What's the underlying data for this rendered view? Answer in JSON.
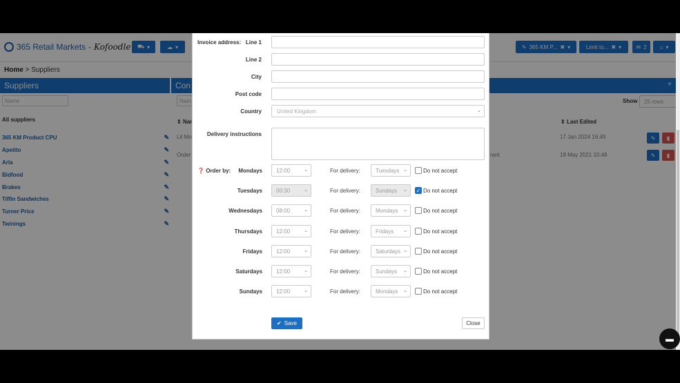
{
  "nav": {
    "brand": "365 Retail Markets",
    "brand_sep": "-",
    "brand_sub": "Kofoodle",
    "site_label": "365 KM P...",
    "limit_label": "Limit to...",
    "badge": "2"
  },
  "breadcrumb": {
    "home": "Home",
    "sep": ">",
    "current": "Suppliers"
  },
  "sidebar": {
    "title": "Suppliers",
    "search_placeholder": "Name",
    "all_label": "All suppliers",
    "items": [
      "365 KM Product CPU",
      "Apetito",
      "Arla",
      "Bidfood",
      "Brakes",
      "Tiffin Sandwiches",
      "Turner Price",
      "Twinings"
    ]
  },
  "content": {
    "title": "Con",
    "search_placeholder": "Nam",
    "show_label": "Show",
    "show_value": "25 rows",
    "col_name": "Nam",
    "col_last_edited": "Last Edited",
    "rows": [
      {
        "name": "Lit Mo",
        "extra": "",
        "edited": "17 Jan 2024 16:49"
      },
      {
        "name": "Order",
        "extra": "rant",
        "edited": "19 May 2021 10:48"
      }
    ]
  },
  "modal": {
    "invoice_label": "Invoice address:",
    "line1_label": "Line 1",
    "line2_label": "Line 2",
    "city_label": "City",
    "postcode_label": "Post code",
    "country_label": "Country",
    "country_value": "United Kingdom",
    "delivery_label": "Delivery instructions",
    "order_by_label": "Order by:",
    "for_delivery_label": "For delivery:",
    "do_not_accept_label": "Do not accept",
    "days": [
      {
        "day": "Mondays",
        "time": "12:00",
        "delivery": "Tuesdays",
        "disabled": false,
        "checked": false
      },
      {
        "day": "Tuesdays",
        "time": "00:30",
        "delivery": "Sundays",
        "disabled": true,
        "checked": true
      },
      {
        "day": "Wednesdays",
        "time": "08:00",
        "delivery": "Mondays",
        "disabled": false,
        "checked": false
      },
      {
        "day": "Thursdays",
        "time": "12:00",
        "delivery": "Fridays",
        "disabled": false,
        "checked": false
      },
      {
        "day": "Fridays",
        "time": "12:00",
        "delivery": "Saturdays",
        "disabled": false,
        "checked": false
      },
      {
        "day": "Saturdays",
        "time": "12:00",
        "delivery": "Sundays",
        "disabled": false,
        "checked": false
      },
      {
        "day": "Sundays",
        "time": "12:00",
        "delivery": "Mondays",
        "disabled": false,
        "checked": false
      }
    ],
    "save_label": "Save",
    "close_label": "Close"
  },
  "colors": {
    "primary": "#1d6fc6",
    "danger": "#d9534f"
  }
}
